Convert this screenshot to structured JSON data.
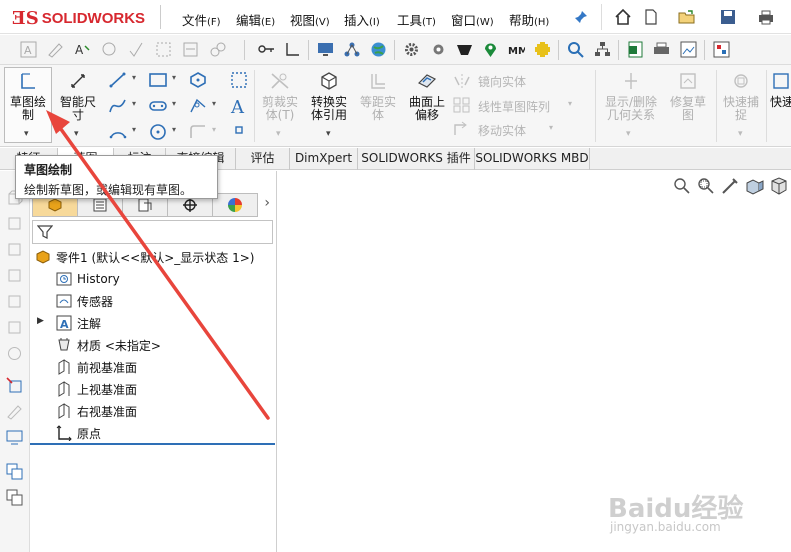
{
  "app": {
    "logo_mark": "ƎS",
    "logo_text": "SOLIDWORKS"
  },
  "menu": [
    {
      "label": "文件",
      "accel": "(F)"
    },
    {
      "label": "编辑",
      "accel": "(E)"
    },
    {
      "label": "视图",
      "accel": "(V)"
    },
    {
      "label": "插入",
      "accel": "(I)"
    },
    {
      "label": "工具",
      "accel": "(T)"
    },
    {
      "label": "窗口",
      "accel": "(W)"
    },
    {
      "label": "帮助",
      "accel": "(H)"
    }
  ],
  "command_manager": {
    "sketch": "草图绘\n制",
    "smart_dim": "智能尺\n寸",
    "trim": "剪裁实\n体(T)",
    "convert": "转换实\n体引用",
    "offset_dist": "等距实\n体",
    "offset_surface": "曲面上\n偏移",
    "mirror": "镜向实体",
    "linear_pattern": "线性草图阵列",
    "move": "移动实体",
    "show_relations": "显示/删除\n几何关系",
    "repair": "修复草\n图",
    "quick_snap": "快速捕\n捉",
    "quick_view": "快速"
  },
  "tabs": [
    "特征",
    "草图",
    "标注",
    "直接编辑",
    "评估",
    "DimXpert",
    "SOLIDWORKS 插件",
    "SOLIDWORKS MBD"
  ],
  "tooltip": {
    "title": "草图绘制",
    "description": "绘制新草图，或编辑现有草图。"
  },
  "tree": {
    "root": "零件1  (默认<<默认>_显示状态 1>)",
    "items": [
      {
        "label": "History",
        "icon": "history-icon"
      },
      {
        "label": "传感器",
        "icon": "sensor-icon"
      },
      {
        "label": "注解",
        "icon": "annotation-icon"
      },
      {
        "label": "材质 <未指定>",
        "icon": "material-icon"
      },
      {
        "label": "前视基准面",
        "icon": "plane-icon"
      },
      {
        "label": "上视基准面",
        "icon": "plane-icon"
      },
      {
        "label": "右视基准面",
        "icon": "plane-icon"
      },
      {
        "label": "原点",
        "icon": "origin-icon"
      }
    ]
  },
  "watermark": {
    "brand": "Baidu经验",
    "url": "jingyan.baidu.com"
  },
  "colors": {
    "brand_red": "#d7282f",
    "accent_blue": "#2e6fb6",
    "arrow_red": "#e8453c"
  }
}
